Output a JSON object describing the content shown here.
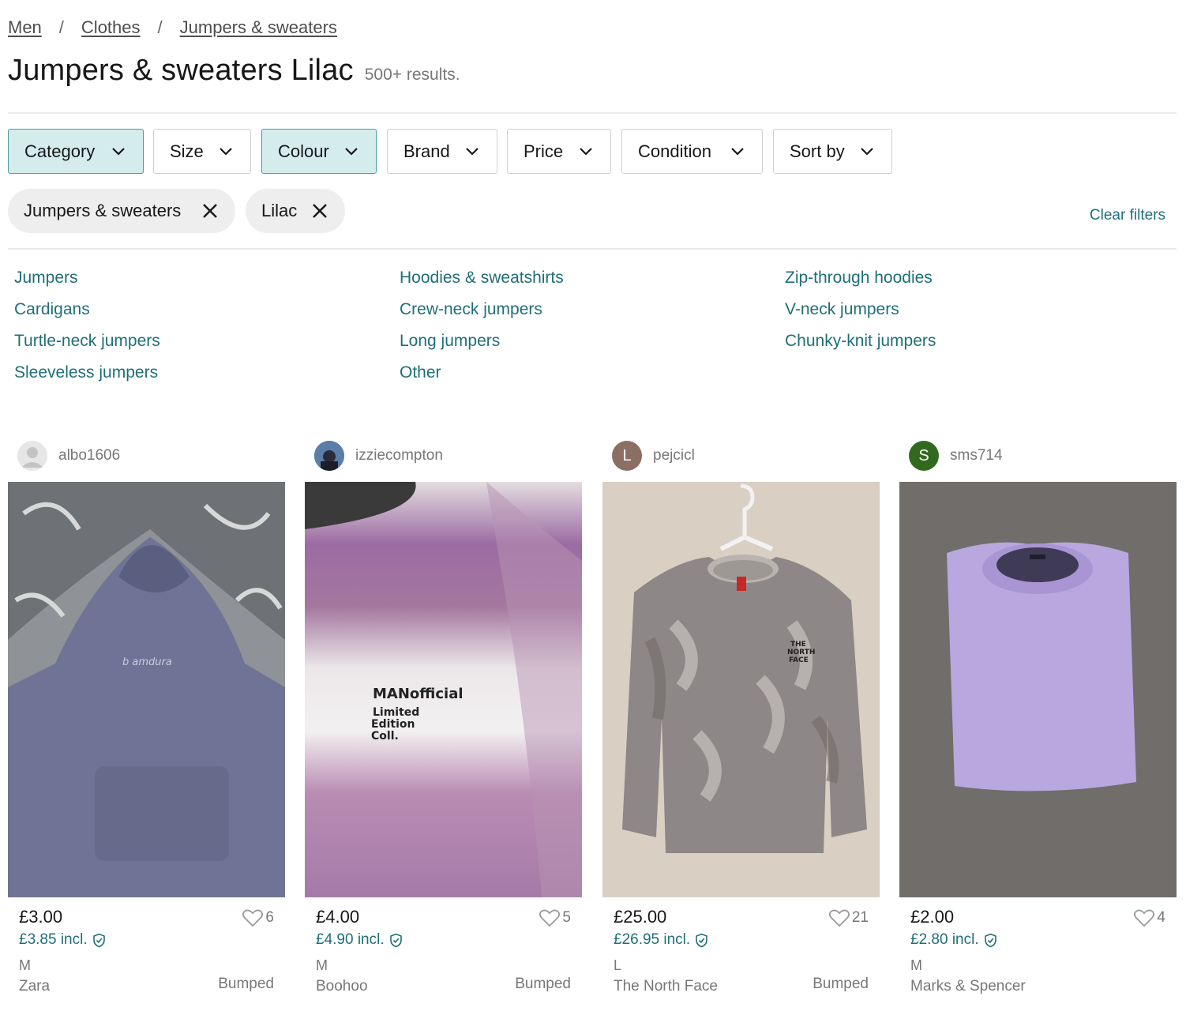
{
  "breadcrumb": {
    "items": [
      "Men",
      "Clothes",
      "Jumpers & sweaters"
    ],
    "separator": "/"
  },
  "header": {
    "title": "Jumpers & sweaters Lilac",
    "results": "500+ results."
  },
  "filters": [
    {
      "label": "Category",
      "active": true
    },
    {
      "label": "Size",
      "active": false
    },
    {
      "label": "Colour",
      "active": true
    },
    {
      "label": "Brand",
      "active": false
    },
    {
      "label": "Price",
      "active": false
    },
    {
      "label": "Condition",
      "active": false
    },
    {
      "label": "Sort by",
      "active": false
    }
  ],
  "chips": [
    {
      "label": "Jumpers & sweaters"
    },
    {
      "label": "Lilac"
    }
  ],
  "clear_filters": "Clear filters",
  "subcategories": [
    [
      "Jumpers",
      "Cardigans",
      "Turtle-neck jumpers",
      "Sleeveless jumpers"
    ],
    [
      "Hoodies & sweatshirts",
      "Crew-neck jumpers",
      "Long jumpers",
      "Other"
    ],
    [
      "Zip-through hoodies",
      "V-neck jumpers",
      "Chunky-knit jumpers"
    ]
  ],
  "items": [
    {
      "seller": "albo1606",
      "avatar_letter": "",
      "avatar_color": "#e6e6e6",
      "price": "£3.00",
      "price_incl": "£3.85 incl.",
      "likes": "6",
      "size": "M",
      "brand": "Zara",
      "status": "Bumped",
      "item_color": "#6f7496"
    },
    {
      "seller": "izziecompton",
      "avatar_letter": "",
      "avatar_color": "#3d5a80",
      "price": "£4.00",
      "price_incl": "£4.90 incl.",
      "likes": "5",
      "size": "M",
      "brand": "Boohoo",
      "status": "Bumped",
      "item_color": "#a0769f",
      "print_text": [
        "MANofficial",
        "Limited",
        "Edition",
        "Coll."
      ]
    },
    {
      "seller": "pejcicl",
      "avatar_letter": "L",
      "avatar_color": "#8d6e63",
      "price": "£25.00",
      "price_incl": "£26.95 incl.",
      "likes": "21",
      "size": "L",
      "brand": "The North Face",
      "status": "Bumped",
      "item_color": "#8e8787"
    },
    {
      "seller": "sms714",
      "avatar_letter": "S",
      "avatar_color": "#33691e",
      "price": "£2.00",
      "price_incl": "£2.80 incl.",
      "likes": "4",
      "size": "M",
      "brand": "Marks & Spencer",
      "status": "",
      "item_color": "#b9a7df"
    }
  ],
  "colors": {
    "accent": "#1f6f78",
    "active_filter_bg": "#d5ecec",
    "chip_bg": "#eeeeee"
  }
}
